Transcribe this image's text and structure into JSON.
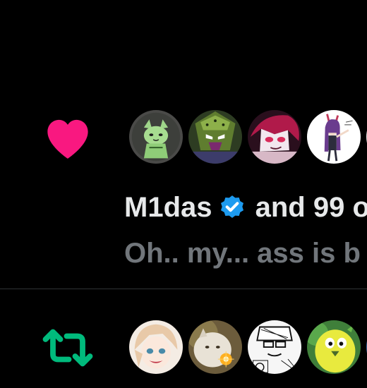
{
  "like_notification": {
    "type_icon": "heart-icon",
    "icon_color": "#f91880",
    "avatars": [
      "avatar-green-cat",
      "avatar-cell-character",
      "avatar-red-hair-character",
      "avatar-purple-hair-character"
    ],
    "actor_name": "M1das",
    "verified": true,
    "verified_color": "#1d9bf0",
    "others_text": " and 99 o",
    "post_preview": "Oh.. my... ass is b"
  },
  "repost_notification": {
    "type_icon": "retweet-icon",
    "icon_color": "#00ba7c",
    "avatars": [
      "avatar-anime-blonde",
      "avatar-cat-photo",
      "avatar-manga-sketch",
      "avatar-green-yellow-bird"
    ]
  },
  "colors": {
    "background": "#000000",
    "primary_text": "#e7e9ea",
    "secondary_text": "#71767b",
    "divider": "#2f3336"
  }
}
